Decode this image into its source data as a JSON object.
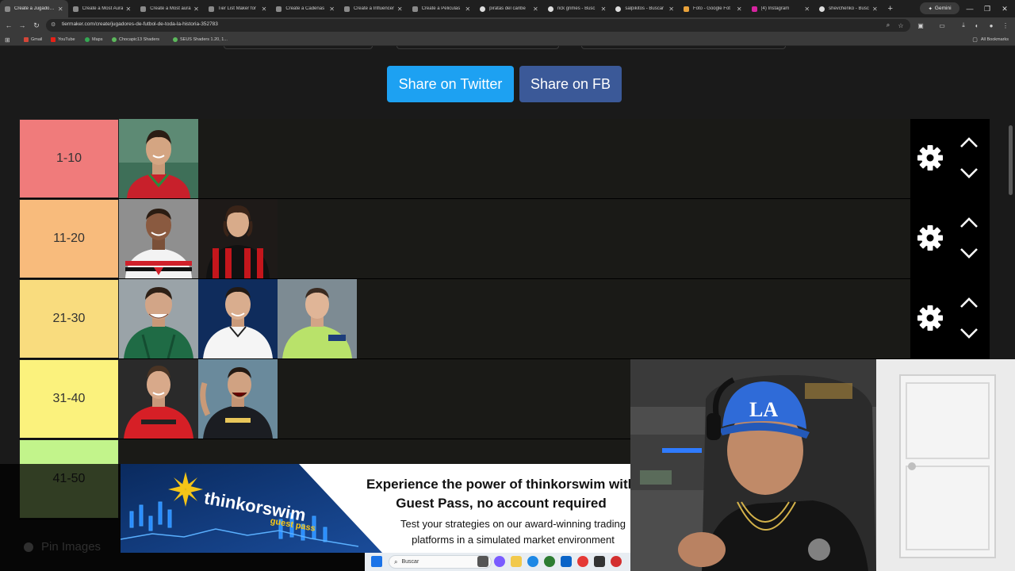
{
  "browser": {
    "tabs": [
      {
        "label": "Create a Jugadores de",
        "active": true
      },
      {
        "label": "Create a Most Aura",
        "active": false
      },
      {
        "label": "Create a Most aura",
        "active": false
      },
      {
        "label": "Tier List Maker for",
        "active": false
      },
      {
        "label": "Create a Cadenas",
        "active": false
      },
      {
        "label": "Create a Influencer",
        "active": false
      },
      {
        "label": "Create a Peliculas",
        "active": false
      },
      {
        "label": "piratas del caribe",
        "active": false
      },
      {
        "label": "rick grimes - Busc",
        "active": false
      },
      {
        "label": "salpikitos - Buscar",
        "active": false
      },
      {
        "label": "Foto - Google Fot",
        "active": false
      },
      {
        "label": "(4) Instagram",
        "active": false
      },
      {
        "label": "shevchenko - Busc",
        "active": false
      }
    ],
    "gemini_label": "Gemini",
    "url": "tiermaker.com/create/jugadores-de-futbol-de-toda-la-historia-352783",
    "bookmarks": [
      "Gmail",
      "YouTube",
      "Maps",
      "Chocapic13 Shaders",
      "SEUS Shaders 1.20, 1..."
    ],
    "all_bookmarks": "All Bookmarks"
  },
  "page": {
    "share_twitter": "Share on Twitter",
    "share_fb": "Share on FB",
    "pin_images": "Pin Images"
  },
  "tiers": [
    {
      "label": "1-10",
      "color": "#f07b7b",
      "item_count": 1
    },
    {
      "label": "11-20",
      "color": "#f8bb7c",
      "item_count": 2
    },
    {
      "label": "21-30",
      "color": "#f9dc7e",
      "item_count": 3
    },
    {
      "label": "31-40",
      "color": "#fbf27d",
      "item_count": 2
    },
    {
      "label": "41-50",
      "color": "#c2f48b",
      "item_count": 0
    }
  ],
  "ad": {
    "brand": "thinkorswim",
    "brand_sub": "guest pass",
    "headline": "Experience the power of thinkorswim with Guest Pass, no account required",
    "subtext": "Test your strategies on our award-winning trading platforms in a simulated market environment"
  },
  "taskbar": {
    "search_label": "Buscar"
  },
  "colors": {
    "twitter": "#1da1f2",
    "facebook": "#3b5998",
    "page_bg": "#1a1a1a"
  }
}
